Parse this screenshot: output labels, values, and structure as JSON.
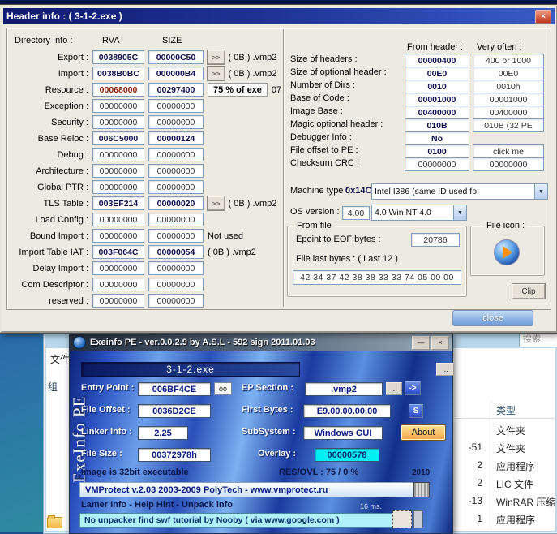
{
  "colors": {
    "header_titlebar": "#101a6e",
    "exeinfo_stripe_blue": "#2a50c0",
    "overlay_field_bg": "#00f0f4",
    "unpack_box_bg": "#b0f0f8",
    "about_button_bg": "#f0a838",
    "resource_rva_red": "#8b1a00"
  },
  "header_window": {
    "title": "Header info : ( 3-1-2.exe )",
    "close_x": "×",
    "directory": {
      "label": "Directory Info :",
      "col_rva": "RVA",
      "col_size": "SIZE",
      "rows": [
        {
          "label": "Export :",
          "rva": "0038905C",
          "size": "00000C50",
          "button": ">>",
          "note": "( 0B ) .vmp2"
        },
        {
          "label": "Import :",
          "rva": "0038B0BC",
          "size": "000000B4",
          "button": ">>",
          "note": "( 0B ) .vmp2"
        },
        {
          "label": "Resource :",
          "rva": "00068000",
          "size": "00297400",
          "percent": "75 % of exe",
          "extra": "07"
        },
        {
          "label": "Exception :",
          "rva": "00000000",
          "size": "00000000"
        },
        {
          "label": "Security :",
          "rva": "00000000",
          "size": "00000000"
        },
        {
          "label": "Base Reloc :",
          "rva": "006C5000",
          "size": "00000124"
        },
        {
          "label": "Debug :",
          "rva": "00000000",
          "size": "00000000"
        },
        {
          "label": "Architecture :",
          "rva": "00000000",
          "size": "00000000"
        },
        {
          "label": "Global PTR :",
          "rva": "00000000",
          "size": "00000000"
        },
        {
          "label": "TLS Table :",
          "rva": "003EF214",
          "size": "00000020",
          "button": ">>",
          "note": "( 0B ) .vmp2"
        },
        {
          "label": "Load Config :",
          "rva": "00000000",
          "size": "00000000"
        },
        {
          "label": "Bound Import :",
          "rva": "00000000",
          "size": "00000000",
          "note": "Not used"
        },
        {
          "label": "Import Table IAT :",
          "rva": "003F064C",
          "size": "00000054",
          "note": "( 0B ) .vmp2"
        },
        {
          "label": "Delay Import :",
          "rva": "00000000",
          "size": "00000000"
        },
        {
          "label": "Com Descriptor :",
          "rva": "00000000",
          "size": "00000000"
        },
        {
          "label": "reserved :",
          "rva": "00000000",
          "size": "00000000"
        }
      ]
    },
    "from_header_col": "From header :",
    "very_often_col": "Very often :",
    "fields": [
      {
        "label": "Size of headers :",
        "value": "00000400",
        "often": "400 or 1000"
      },
      {
        "label": "Size of optional header :",
        "value": "00E0",
        "often": "00E0"
      },
      {
        "label": "Number of Dirs :",
        "value": "0010",
        "often": "0010h"
      },
      {
        "label": "Base of Code :",
        "value": "00001000",
        "often": "00001000"
      },
      {
        "label": "Image Base :",
        "value": "00400000",
        "often": "00400000"
      },
      {
        "label": "Magic optional header :",
        "value": "010B",
        "often": "010B (32 PE"
      },
      {
        "label": "Debugger Info :",
        "value": "No"
      },
      {
        "label": "File offset to PE :",
        "value": "0100",
        "often": "click me"
      },
      {
        "label": "Checksum CRC :",
        "value": "00000000",
        "often": "00000000"
      }
    ],
    "machine": {
      "label": "Machine type :",
      "value": "0x14C",
      "combo": "Intel I386 (same ID used fo"
    },
    "os": {
      "label": "OS version   :",
      "value": "4.00",
      "combo": "4.0 Win NT 4.0"
    },
    "from_file": {
      "legend": "From file",
      "epoint_label": "Epoint to EOF bytes :",
      "epoint_value": "20786",
      "last_bytes_label": "File last bytes : ( Last 12 )",
      "last_bytes": "42 34 37 42 38 38 33 33 74 05 00 00",
      "clip": "Clip"
    },
    "file_icon_legend": "File icon :",
    "close_button": "close"
  },
  "exeinfo": {
    "title": "Exeinfo PE - ver.0.0.2.9  by A.S.L -  592 sign 2011.01.03",
    "min_glyph": "—",
    "close_glyph": "×",
    "brand": "ExeInfo PE",
    "filename": "3-1-2.exe",
    "browse_dots": "...",
    "entry_point": {
      "label": "Entry Point :",
      "value": "006BF4CE",
      "plugin_btn": "oo"
    },
    "ep_section": {
      "label": "EP Section :",
      "value": ".vmp2",
      "dots": "...",
      "arrow": "->"
    },
    "file_offset": {
      "label": "File Offset :",
      "value": "0036D2CE"
    },
    "first_bytes": {
      "label": "First Bytes :",
      "value": "E9.00.00.00.00",
      "s_btn": "S"
    },
    "linker": {
      "label": "Linker Info :",
      "value": "2.25"
    },
    "subsystem": {
      "label": "SubSystem :",
      "value": "Windows GUI",
      "about_btn": "About"
    },
    "file_size": {
      "label": "File Size :",
      "value": "00372978h"
    },
    "overlay": {
      "label": "Overlay :",
      "value": "00000578"
    },
    "image_info": "Image is 32bit executable",
    "res_ovl": "RES/OVL : 75 / 0 %",
    "year": "2010",
    "scanner_result": "VMProtect v.2.03  2003-2009 PolyTech - www.vmprotect.ru",
    "lamer_info": "Lamer Info - Help Hint - Unpack info",
    "scan_time": "16 ms.",
    "unpack_info": "No unpacker  find swf tutorial by Nooby ( via www.google.com )"
  },
  "explorer": {
    "search_text": "搜索",
    "menu_file": "文件",
    "toolbar_organize": "组",
    "column_type": "类型",
    "rows": [
      {
        "tail": "",
        "type": "文件夹"
      },
      {
        "tail": "-51",
        "type": "文件夹"
      },
      {
        "tail": "2",
        "type": "应用程序"
      },
      {
        "tail": "2",
        "type": "LIC 文件"
      },
      {
        "tail": "-13",
        "type": "WinRAR 压缩"
      },
      {
        "tail": "1",
        "type": "应用程序"
      }
    ]
  }
}
